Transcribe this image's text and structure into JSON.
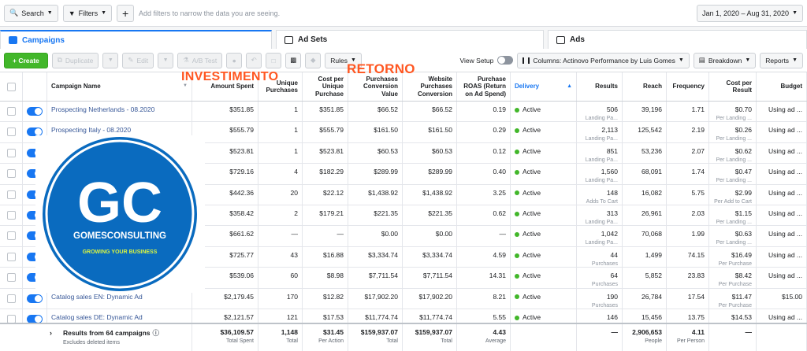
{
  "topbar": {
    "search_label": "Search",
    "filters_label": "Filters",
    "add_label": "+",
    "hint": "Add filters to narrow the data you are seeing.",
    "date_range": "Jan 1, 2020 – Aug 31, 2020"
  },
  "tabs": [
    {
      "label": "Campaigns",
      "icon": "campaigns-icon"
    },
    {
      "label": "Ad Sets",
      "icon": "adsets-icon"
    },
    {
      "label": "Ads",
      "icon": "ads-icon"
    }
  ],
  "toolbar": {
    "create": "+ Create",
    "duplicate": "Duplicate",
    "edit": "Edit",
    "ab_test": "A/B Test",
    "rules": "Rules",
    "view_setup": "View Setup",
    "columns": "Columns: Actinovo Performance by Luis Gomes",
    "breakdown": "Breakdown",
    "reports": "Reports"
  },
  "annotations": {
    "investimento": "INVESTIMENTO",
    "retorno": "RETORNO"
  },
  "columns": [
    "Campaign Name",
    "Amount Spent",
    "Unique Purchases",
    "Cost per Unique Purchase",
    "Purchases Conversion Value",
    "Website Purchases Conversion",
    "Purchase ROAS (Return on Ad Spend)",
    "Delivery",
    "Results",
    "Reach",
    "Frequency",
    "Cost per Result",
    "Budget"
  ],
  "rows": [
    {
      "name": "Prospecting Netherlands - 08.2020",
      "spent": "$351.85",
      "unique": "1",
      "cpu": "$351.85",
      "pcv": "$66.52",
      "wpc": "$66.52",
      "roas": "0.19",
      "delivery": "Active",
      "results": "506",
      "results_sub": "Landing Pa...",
      "reach": "39,196",
      "freq": "1.71",
      "cpr": "$0.70",
      "cpr_sub": "Per Landing ...",
      "budget": "Using ad ..."
    },
    {
      "name": "Prospecting Italy - 08.2020",
      "spent": "$555.79",
      "unique": "1",
      "cpu": "$555.79",
      "pcv": "$161.50",
      "wpc": "$161.50",
      "roas": "0.29",
      "delivery": "Active",
      "results": "2,113",
      "results_sub": "Landing Pa...",
      "reach": "125,542",
      "freq": "2.19",
      "cpr": "$0.26",
      "cpr_sub": "Per Landing ...",
      "budget": "Using ad ..."
    },
    {
      "name": "",
      "spent": "$523.81",
      "unique": "1",
      "cpu": "$523.81",
      "pcv": "$60.53",
      "wpc": "$60.53",
      "roas": "0.12",
      "delivery": "Active",
      "results": "851",
      "results_sub": "Landing Pa...",
      "reach": "53,236",
      "freq": "2.07",
      "cpr": "$0.62",
      "cpr_sub": "Per Landing ...",
      "budget": "Using ad ..."
    },
    {
      "name": "",
      "spent": "$729.16",
      "unique": "4",
      "cpu": "$182.29",
      "pcv": "$289.99",
      "wpc": "$289.99",
      "roas": "0.40",
      "delivery": "Active",
      "results": "1,560",
      "results_sub": "Landing Pa...",
      "reach": "68,091",
      "freq": "1.74",
      "cpr": "$0.47",
      "cpr_sub": "Per Landing ...",
      "budget": "Using ad ..."
    },
    {
      "name": "",
      "spent": "$442.36",
      "unique": "20",
      "cpu": "$22.12",
      "pcv": "$1,438.92",
      "wpc": "$1,438.92",
      "roas": "3.25",
      "delivery": "Active",
      "results": "148",
      "results_sub": "Adds To Cart",
      "reach": "16,082",
      "freq": "5.75",
      "cpr": "$2.99",
      "cpr_sub": "Per Add to Cart",
      "budget": "Using ad ..."
    },
    {
      "name": "",
      "spent": "$358.42",
      "unique": "2",
      "cpu": "$179.21",
      "pcv": "$221.35",
      "wpc": "$221.35",
      "roas": "0.62",
      "delivery": "Active",
      "results": "313",
      "results_sub": "Landing Pa...",
      "reach": "26,961",
      "freq": "2.03",
      "cpr": "$1.15",
      "cpr_sub": "Per Landing ...",
      "budget": "Using ad ..."
    },
    {
      "name": "",
      "spent": "$661.62",
      "unique": "—",
      "cpu": "—",
      "pcv": "$0.00",
      "wpc": "$0.00",
      "roas": "—",
      "delivery": "Active",
      "results": "1,042",
      "results_sub": "Landing Pa...",
      "reach": "70,068",
      "freq": "1.99",
      "cpr": "$0.63",
      "cpr_sub": "Per Landing ...",
      "budget": "Using ad ..."
    },
    {
      "name": "",
      "spent": "$725.77",
      "unique": "43",
      "cpu": "$16.88",
      "pcv": "$3,334.74",
      "wpc": "$3,334.74",
      "roas": "4.59",
      "delivery": "Active",
      "results": "44",
      "results_sub": "Purchases",
      "reach": "1,499",
      "freq": "74.15",
      "cpr": "$16.49",
      "cpr_sub": "Per Purchase",
      "budget": "Using ad ..."
    },
    {
      "name": "",
      "spent": "$539.06",
      "unique": "60",
      "cpu": "$8.98",
      "pcv": "$7,711.54",
      "wpc": "$7,711.54",
      "roas": "14.31",
      "delivery": "Active",
      "results": "64",
      "results_sub": "Purchases",
      "reach": "5,852",
      "freq": "23.83",
      "cpr": "$8.42",
      "cpr_sub": "Per Purchase",
      "budget": "Using ad ..."
    },
    {
      "name": "Catalog sales EN: Dynamic Ad",
      "spent": "$2,179.45",
      "unique": "170",
      "cpu": "$12.82",
      "pcv": "$17,902.20",
      "wpc": "$17,902.20",
      "roas": "8.21",
      "delivery": "Active",
      "results": "190",
      "results_sub": "Purchases",
      "reach": "26,784",
      "freq": "17.54",
      "cpr": "$11.47",
      "cpr_sub": "Per Purchase",
      "budget": "$15.00"
    },
    {
      "name": "Catalog sales DE: Dynamic Ad",
      "spent": "$2,121.57",
      "unique": "121",
      "cpu": "$17.53",
      "pcv": "$11,774.74",
      "wpc": "$11,774.74",
      "roas": "5.55",
      "delivery": "Active",
      "results": "146",
      "results_sub": "Purchases",
      "reach": "15,456",
      "freq": "13.75",
      "cpr": "$14.53",
      "cpr_sub": "Per Purchase",
      "budget": "Using ad ..."
    }
  ],
  "footer": {
    "title": "Results from 64 campaigns",
    "subtitle": "Excludes deleted items",
    "spent": "$36,109.57",
    "spent_sub": "Total Spent",
    "unique": "1,148",
    "unique_sub": "Total",
    "cpu": "$31.45",
    "cpu_sub": "Per Action",
    "pcv": "$159,937.07",
    "pcv_sub": "Total",
    "wpc": "$159,937.07",
    "wpc_sub": "Total",
    "roas": "4.43",
    "roas_sub": "Average",
    "results": "—",
    "reach": "2,906,653",
    "reach_sub": "People",
    "freq": "4.11",
    "freq_sub": "Per Person",
    "cpr": "—",
    "budget": ""
  },
  "logo": {
    "letters": "GC",
    "name": "GOMESCONSULTING",
    "tagline": "GROWING YOUR BUSINESS"
  },
  "colors": {
    "accent": "#1877f2",
    "logo_blue": "#0a6bbf",
    "annotation": "#ff5722",
    "active": "#42b72a"
  }
}
